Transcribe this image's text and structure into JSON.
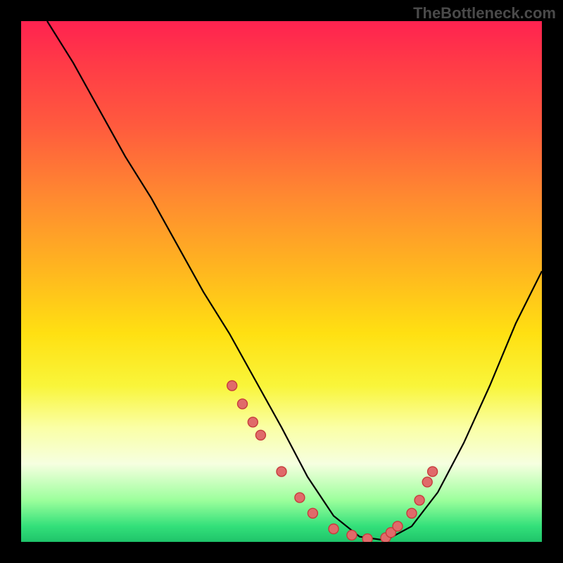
{
  "watermark": "TheBottleneck.com",
  "chart_data": {
    "type": "line",
    "title": "",
    "xlabel": "",
    "ylabel": "",
    "xlim": [
      0,
      100
    ],
    "ylim": [
      0,
      100
    ],
    "series": [
      {
        "name": "curve",
        "x": [
          5,
          10,
          15,
          20,
          25,
          30,
          35,
          40,
          45,
          50,
          55,
          60,
          65,
          70,
          75,
          80,
          85,
          90,
          95,
          100
        ],
        "values": [
          100,
          92,
          83,
          74,
          66,
          57,
          48,
          40,
          31,
          22,
          12.5,
          5,
          1,
          0.3,
          3,
          9.5,
          19,
          30,
          42,
          52
        ]
      }
    ],
    "markers": {
      "x": [
        40.5,
        42.5,
        44.5,
        46,
        50,
        53.5,
        56,
        60,
        63.5,
        66.5,
        70,
        71,
        72.3,
        75,
        76.5,
        78,
        79
      ],
      "values": [
        30.0,
        26.5,
        23.0,
        20.5,
        13.5,
        8.5,
        5.5,
        2.5,
        1.3,
        0.6,
        0.8,
        1.8,
        3.0,
        5.5,
        8.0,
        11.5,
        13.5
      ]
    },
    "gradient_stops": [
      {
        "pos": 0.0,
        "color": "#ff2250"
      },
      {
        "pos": 0.5,
        "color": "#ffe012"
      },
      {
        "pos": 0.9,
        "color": "#9cff9c"
      },
      {
        "pos": 1.0,
        "color": "#1fc46a"
      }
    ],
    "marker_style": {
      "fill": "#e06a6a",
      "stroke": "#c63c3c",
      "r": 7
    }
  }
}
